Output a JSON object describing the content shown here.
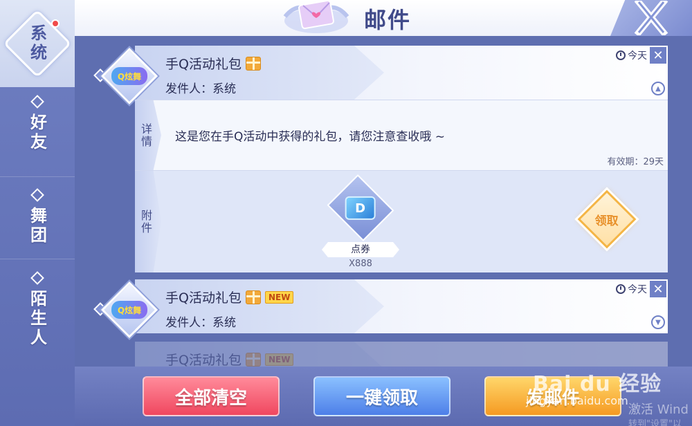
{
  "header": {
    "title": "邮件"
  },
  "tabs": [
    {
      "label": "系统",
      "active": true,
      "has_dot": true
    },
    {
      "label": "好友",
      "active": false
    },
    {
      "label": "舞团",
      "active": false
    },
    {
      "label": "陌生人",
      "active": false
    }
  ],
  "mails": [
    {
      "subject": "手Q活动礼包",
      "sender": "发件人：系统",
      "time": "今天",
      "is_new": false,
      "detail_label": "详情",
      "detail_text": "这是您在手Q活动中获得的礼包，请您注意查收哦 ~",
      "validity": "有效期：29天",
      "attach_label": "附件",
      "attachment": {
        "icon": "D",
        "name": "点券",
        "qty": "X888"
      },
      "claim_label": "领取"
    },
    {
      "subject": "手Q活动礼包",
      "sender": "发件人：系统",
      "time": "今天",
      "is_new": true,
      "new_label": "NEW"
    },
    {
      "subject": "手Q活动礼包",
      "new_label": "NEW"
    }
  ],
  "avatar_text": "Q炫舞",
  "buttons": {
    "clear_all": "全部清空",
    "collect_all": "一键领取",
    "send_mail": "发邮件"
  },
  "watermark": {
    "logo": "Bai du 经验",
    "url": "jingyan.baidu.com"
  },
  "os_overlay": {
    "line1": "激活 Wind",
    "line2": "转到\"设置\"以"
  },
  "colors": {
    "clear_button": "#f0475f",
    "collect_button": "#4d7fe8",
    "send_button": "#f59a22",
    "claim_accent": "#e8912b",
    "notification_dot": "#f04a4a"
  }
}
